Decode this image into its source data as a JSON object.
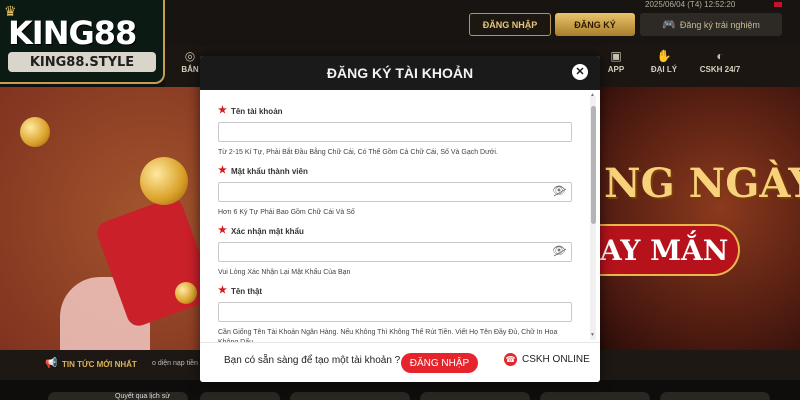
{
  "header": {
    "datetime": "2025/06/04 (T4) 12:52:20",
    "login_label": "ĐĂNG NHẬP",
    "register_label": "ĐĂNG KÝ",
    "trial_label": "Đăng ký trải nghiệm"
  },
  "logo": {
    "brand": "KING88",
    "domain": "KING88.STYLE"
  },
  "nav": {
    "items": [
      {
        "label": "BẮN",
        "icon": "target-icon"
      },
      {
        "label": "APP",
        "icon": "app-icon"
      },
      {
        "label": "ĐẠI LÝ",
        "icon": "handshake-icon"
      },
      {
        "label": "CSKH 24/7",
        "icon": "support-icon"
      }
    ]
  },
  "banner": {
    "line1": "NG NGÀY",
    "line2": "AY MẮN"
  },
  "ticker": {
    "title": "TIN TỨC MỚI NHẤT",
    "text": "o diện nạp tiền"
  },
  "bottom": {
    "label": "Quyết qua lịch sử"
  },
  "modal": {
    "title": "ĐĂNG KÝ TÀI KHOẢN",
    "close_icon": "close-icon",
    "fields": [
      {
        "label": "Tên tài khoản",
        "value": "",
        "hint": "Từ 2-15 Kí Tự, Phải Bắt Đầu Bằng Chữ Cái, Có Thể Gồm Cả Chữ Cái, Số Và Gạch Dưới."
      },
      {
        "label": "Mật khẩu thành viên",
        "value": "",
        "hint": "Hơn 6 Ký Tự Phải Bao Gồm Chữ Cái Và Số"
      },
      {
        "label": "Xác nhận mật khẩu",
        "value": "",
        "hint": "Vui Lòng Xác Nhận Lại Mật Khẩu Của Bạn"
      },
      {
        "label": "Tên thật",
        "value": "",
        "hint": "Cần Giống Tên Tài Khoản Ngân Hàng. Nếu Không Thì Không Thể Rút Tiền. Viết Họ Tên Đầy Đủ, Chữ In Hoa Không Dấu"
      }
    ],
    "footer": {
      "question": "Bạn có sẵn sàng để tạo một tài khoản ?",
      "login_label": "ĐĂNG NHẬP",
      "support_label": "CSKH ONLINE"
    }
  },
  "colors": {
    "accent_red": "#e5252b",
    "gold": "#e9c46a",
    "modal_header": "#1a1a1a"
  }
}
